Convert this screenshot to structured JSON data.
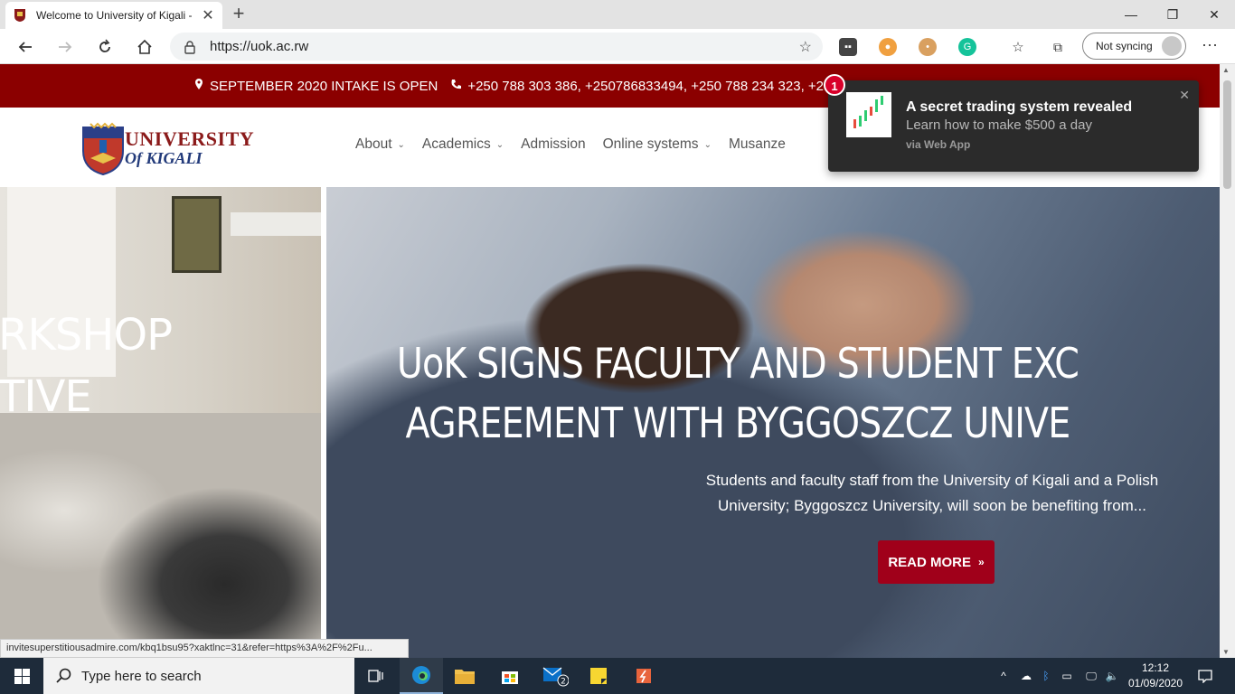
{
  "browser": {
    "tab_title": "Welcome to University of Kigali -",
    "url": "https://uok.ac.rw",
    "sync_label": "Not syncing"
  },
  "site": {
    "topbar": {
      "intake": "SEPTEMBER 2020 INTAKE IS OPEN",
      "phones": "+250 788 303 386, +250786833494, +250 788 234 323, +250"
    },
    "logo": {
      "line1": "UNIVERSITY",
      "line2": "Of KIGALI"
    },
    "nav": [
      {
        "label": "About",
        "dropdown": true
      },
      {
        "label": "Academics",
        "dropdown": true
      },
      {
        "label": "Admission",
        "dropdown": false
      },
      {
        "label": "Online systems",
        "dropdown": true
      },
      {
        "label": "Musanze",
        "dropdown": false
      }
    ],
    "hero": {
      "left_slide_lines": [
        "RKSHOP",
        "TIVE"
      ],
      "headline_lines": [
        "UoK SIGNS FACULTY AND STUDENT EXC",
        "AGREEMENT WITH BYGGOSZCZ UNIVE"
      ],
      "subtext_lines": [
        "Students and faculty staff from the University of Kigali and a Polish",
        "University; Byggoszcz University, will soon be benefiting from..."
      ],
      "cta": "READ MORE",
      "accent_color": "#a0001a"
    }
  },
  "status_url": "invitesuperstitiousadmire.com/kbq1bsu95?xaktlnc=31&refer=https%3A%2F%2Fu...",
  "notification": {
    "badge_count": "1",
    "title": "A secret trading system revealed",
    "body": "Learn how to make $500 a day",
    "source": "via Web App"
  },
  "taskbar": {
    "search_placeholder": "Type here to search",
    "mail_badge": "2",
    "time": "12:12",
    "date": "01/09/2020"
  },
  "colors": {
    "topbar_bg": "#8b0000",
    "taskbar_bg": "#1e2b3a"
  }
}
